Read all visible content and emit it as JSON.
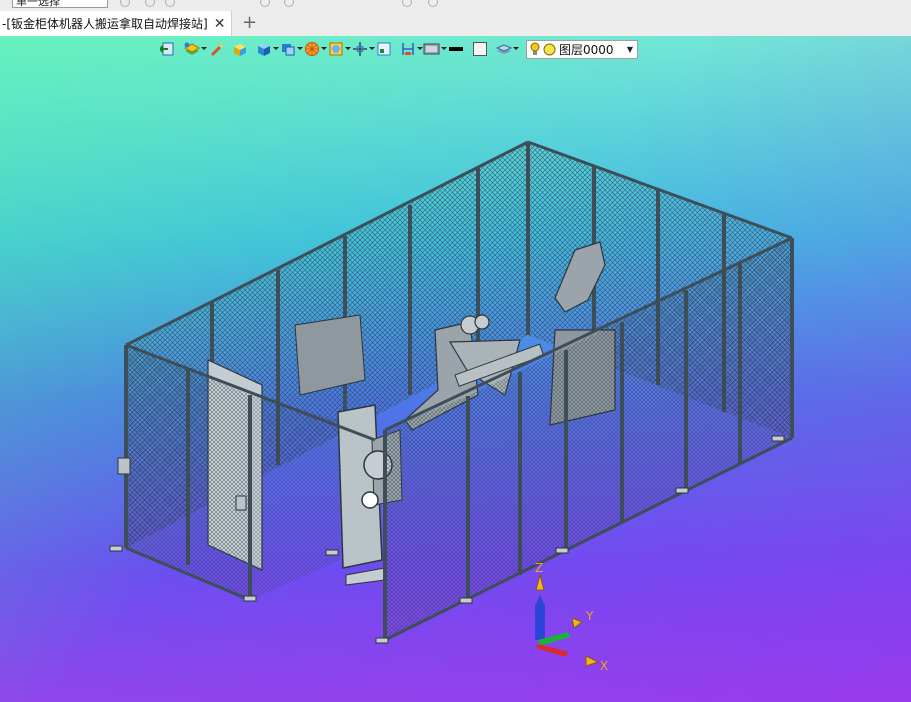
{
  "topbar": {
    "selection_combo": "单一选择"
  },
  "tabs": [
    {
      "prefix": "-",
      "label": "[钣金柜体机器人搬运拿取自动焊接站]",
      "close": "✕"
    }
  ],
  "tab_add": "+",
  "toolbar": {
    "icons": [
      "exit-sketch-icon",
      "layer-manager-icon",
      "draw-brush-icon",
      "solid-box-icon",
      "cube-view-icon",
      "view-orient-icon",
      "render-mode-icon",
      "shading-icon",
      "origin-icon",
      "section-view-icon",
      "measure-icon",
      "display-style-icon",
      "line-color-icon",
      "face-color-icon",
      "layer-stack-icon"
    ],
    "layer": {
      "name": "图层0000",
      "bulb_color": "#f2c81e",
      "dot_color": "#f4e44a"
    }
  },
  "triad": {
    "x_label": "X",
    "y_label": "Y",
    "z_label": "Z"
  },
  "colors": {
    "fence": "#3d4e58",
    "mesh": "#2e3c45",
    "bg_top": "#73e6d6",
    "bg_bottom": "#8f45ec"
  }
}
